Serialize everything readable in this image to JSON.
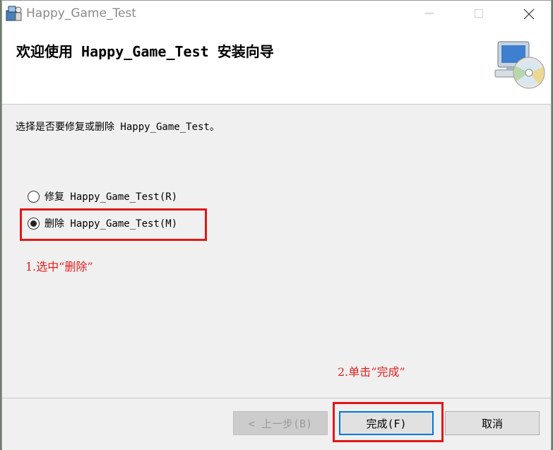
{
  "window": {
    "title": "Happy_Game_Test",
    "icon": "installer-icon",
    "controls": [
      "minimize-icon",
      "maximize-icon",
      "close-icon"
    ]
  },
  "header": {
    "title": "欢迎使用 Happy_Game_Test 安装向导",
    "icon": "computer-cd-icon"
  },
  "body": {
    "prompt": "选择是否要修复或删除 Happy_Game_Test。",
    "options": [
      {
        "label": "修复 Happy_Game_Test(R)",
        "selected": false
      },
      {
        "label": "删除 Happy_Game_Test(M)",
        "selected": true
      }
    ]
  },
  "annotations": {
    "step1": "1.选中“删除”",
    "step2": "2.单击“完成”",
    "color": "#e02020"
  },
  "footer": {
    "back_label": "< 上一步(B)",
    "finish_label": "完成(F)",
    "cancel_label": "取消"
  }
}
